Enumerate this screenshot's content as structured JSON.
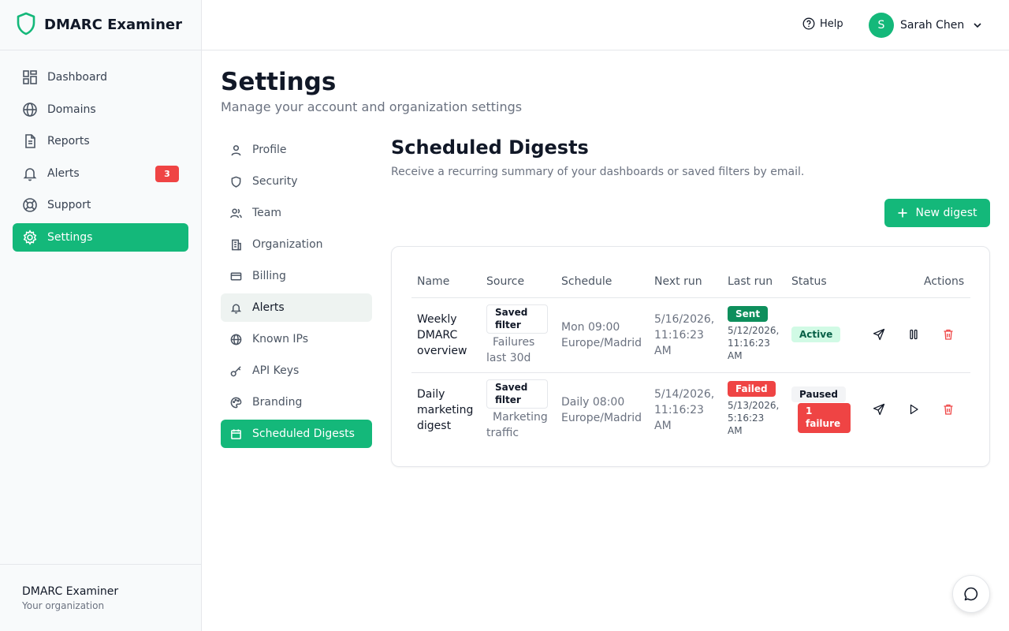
{
  "app": {
    "name": "DMARC Examiner"
  },
  "sidebar": {
    "items": [
      {
        "label": "Dashboard",
        "icon": "dashboard-icon"
      },
      {
        "label": "Domains",
        "icon": "globe-icon"
      },
      {
        "label": "Reports",
        "icon": "file-icon"
      },
      {
        "label": "Alerts",
        "icon": "bell-icon",
        "badge": "3"
      },
      {
        "label": "Support",
        "icon": "lifebuoy-icon"
      },
      {
        "label": "Settings",
        "icon": "gear-icon",
        "active": true
      }
    ],
    "footer": {
      "org_name": "DMARC Examiner",
      "org_sub": "Your organization"
    }
  },
  "header": {
    "help_label": "Help",
    "user": {
      "initial": "S",
      "name": "Sarah Chen"
    }
  },
  "page": {
    "title": "Settings",
    "subtitle": "Manage your account and organization settings"
  },
  "settings_nav": [
    {
      "label": "Profile",
      "icon": "user-icon"
    },
    {
      "label": "Security",
      "icon": "shield-icon"
    },
    {
      "label": "Team",
      "icon": "users-icon"
    },
    {
      "label": "Organization",
      "icon": "building-icon"
    },
    {
      "label": "Billing",
      "icon": "credit-card-icon"
    },
    {
      "label": "Alerts",
      "icon": "bell-icon",
      "hovered": true
    },
    {
      "label": "Known IPs",
      "icon": "globe-icon"
    },
    {
      "label": "API Keys",
      "icon": "key-icon"
    },
    {
      "label": "Branding",
      "icon": "palette-icon"
    },
    {
      "label": "Scheduled Digests",
      "icon": "calendar-icon",
      "active": true
    }
  ],
  "digests": {
    "title": "Scheduled Digests",
    "subtitle": "Receive a recurring summary of your dashboards or saved filters by email.",
    "new_button": "New digest",
    "columns": [
      "Name",
      "Source",
      "Schedule",
      "Next run",
      "Last run",
      "Status",
      "Actions"
    ],
    "rows": [
      {
        "name": [
          "Weekly",
          "DMARC",
          "overview"
        ],
        "source_chip": [
          "Saved",
          "filter"
        ],
        "source_text": [
          "Failures",
          "last 30d"
        ],
        "schedule": [
          "Mon 09:00",
          "Europe/Madrid"
        ],
        "next_run": [
          "5/16/2026,",
          "11:16:23",
          "AM"
        ],
        "last_status": "Sent",
        "last_time": [
          "5/12/2026,",
          "11:16:23",
          "AM"
        ],
        "status": "Active",
        "failure_badge": null
      },
      {
        "name": [
          "Daily",
          "marketing",
          "digest"
        ],
        "source_chip": [
          "Saved",
          "filter"
        ],
        "source_text": [
          "Marketing",
          "traffic"
        ],
        "schedule": [
          "Daily 08:00",
          "Europe/Madrid"
        ],
        "next_run": [
          "5/14/2026,",
          "11:16:23",
          "AM"
        ],
        "last_status": "Failed",
        "last_time": [
          "5/13/2026,",
          "5:16:23",
          "AM"
        ],
        "status": "Paused",
        "failure_badge": [
          "1",
          "failure"
        ]
      }
    ]
  },
  "colors": {
    "accent": "#14b87a",
    "danger": "#ef4444",
    "sent": "#0e8f5c"
  }
}
